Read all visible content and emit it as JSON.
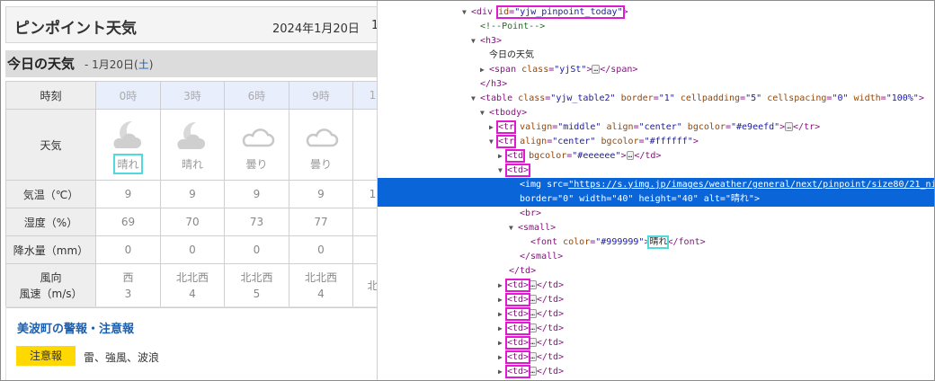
{
  "page": {
    "title": "ピンポイント天気",
    "date": "2024年1月20日",
    "date_cut": "1",
    "today_title": "今日の天気",
    "today_date_prefix": "- 1月20日(",
    "today_date_weekday": "土",
    "today_date_suffix": ")"
  },
  "table": {
    "headers": [
      "時刻",
      "0時",
      "3時",
      "6時",
      "9時",
      "1"
    ],
    "weather_label": "天気",
    "weather": [
      {
        "icon": "moon-cloud-icon",
        "label": "晴れ"
      },
      {
        "icon": "moon-cloud-icon",
        "label": "晴れ"
      },
      {
        "icon": "cloud-icon",
        "label": "曇り"
      },
      {
        "icon": "cloud-icon",
        "label": "曇り"
      }
    ],
    "rows": [
      {
        "label": "気温（℃）",
        "values": [
          "9",
          "9",
          "9",
          "9",
          "1"
        ]
      },
      {
        "label": "湿度（%）",
        "values": [
          "69",
          "70",
          "73",
          "77",
          ""
        ]
      },
      {
        "label": "降水量（mm）",
        "values": [
          "0",
          "0",
          "0",
          "0",
          ""
        ]
      }
    ],
    "wind_label_1": "風向",
    "wind_label_2": "風速（m/s）",
    "wind": [
      {
        "dir": "西",
        "speed": "3"
      },
      {
        "dir": "北北西",
        "speed": "4"
      },
      {
        "dir": "北北西",
        "speed": "5"
      },
      {
        "dir": "北北西",
        "speed": "4"
      },
      {
        "dir": "北",
        "speed": ""
      }
    ]
  },
  "warnings": {
    "title": "美波町の警報・注意報",
    "badge": "注意報",
    "text": "雷、強風、波浪"
  },
  "devtools": {
    "l1_open": "<div ",
    "l1_attr": "id",
    "l1_eq": "=",
    "l1_val": "\"yjw_pinpoint_today\"",
    "l1_close": ">",
    "l2_comment": "<!--Point-->",
    "l3": "<h3>",
    "l4_text": "今日の天気",
    "l5_open": "<span ",
    "l5_attr": "class",
    "l5_val": "\"yjSt\"",
    "l5_close_a": ">",
    "l5_close_b": "</span>",
    "l6": "</h3>",
    "l7_open": "<table ",
    "l7_attr_class": "class",
    "l7_val_class": "\"yjw_table2\"",
    "l7_attr_border": "border",
    "l7_val_border": "\"1\"",
    "l7_attr_cellpadding": "cellpadding",
    "l7_val_cellpadding": "\"5\"",
    "l7_attr_cellspacing": "cellspacing",
    "l7_val_cellspacing": "\"0\"",
    "l7_attr_width": "width",
    "l7_val_width": "\"100%\"",
    "l7_close": ">",
    "l8": "<tbody>",
    "l9_tag": "<tr",
    "l9_attr_valign": "valign",
    "l9_val_valign": "\"middle\"",
    "l9_attr_align": "align",
    "l9_val_align": "\"center\"",
    "l9_attr_bg": "bgcolor",
    "l9_val_bg": "\"#e9eefd\"",
    "l9_close_a": ">",
    "l9_close_b": "</tr>",
    "l10_tag": "<tr",
    "l10_attr_align": "align",
    "l10_val_align": "\"center\"",
    "l10_attr_bg": "bgcolor",
    "l10_val_bg": "\"#ffffff\"",
    "l10_close": ">",
    "l11_tag": "<td",
    "l11_attr_bg": "bgcolor",
    "l11_val_bg": "\"#eeeeee\"",
    "l11_close_a": ">",
    "l11_close_b": "</td>",
    "l12_tag": "<td>",
    "l13_open": "<img ",
    "l13_attr_src": "src",
    "l13_val_src": "\"https://s.yimg.jp/images/weather/general/next/pinpoint/size80/21_ni",
    "l14_attr_border": "border",
    "l14_val_border": "\"0\"",
    "l14_attr_width": "width",
    "l14_val_width": "\"40\"",
    "l14_attr_height": "height",
    "l14_val_height": "\"40\"",
    "l14_attr_alt": "alt",
    "l14_val_alt": "\"晴れ\"",
    "l14_close": ">",
    "l15": "<br>",
    "l16": "<small>",
    "l17_open": "<font ",
    "l17_attr": "color",
    "l17_val": "\"#999999\"",
    "l17_gt": ">",
    "l17_text": "晴れ",
    "l17_close": "</font>",
    "l18": "</small>",
    "l19": "</td>",
    "td_tag": "<td>",
    "td_close": "</td>",
    "ellipsis": "…"
  },
  "colors": {
    "selection": "#0a66d8",
    "highlight_magenta": "#e01ad0",
    "highlight_cyan": "#4fdadc",
    "warning_badge": "#ffd800",
    "link_blue": "#1b5fb0",
    "header_row": "#e9eefd",
    "label_cell": "#eeeeee"
  }
}
